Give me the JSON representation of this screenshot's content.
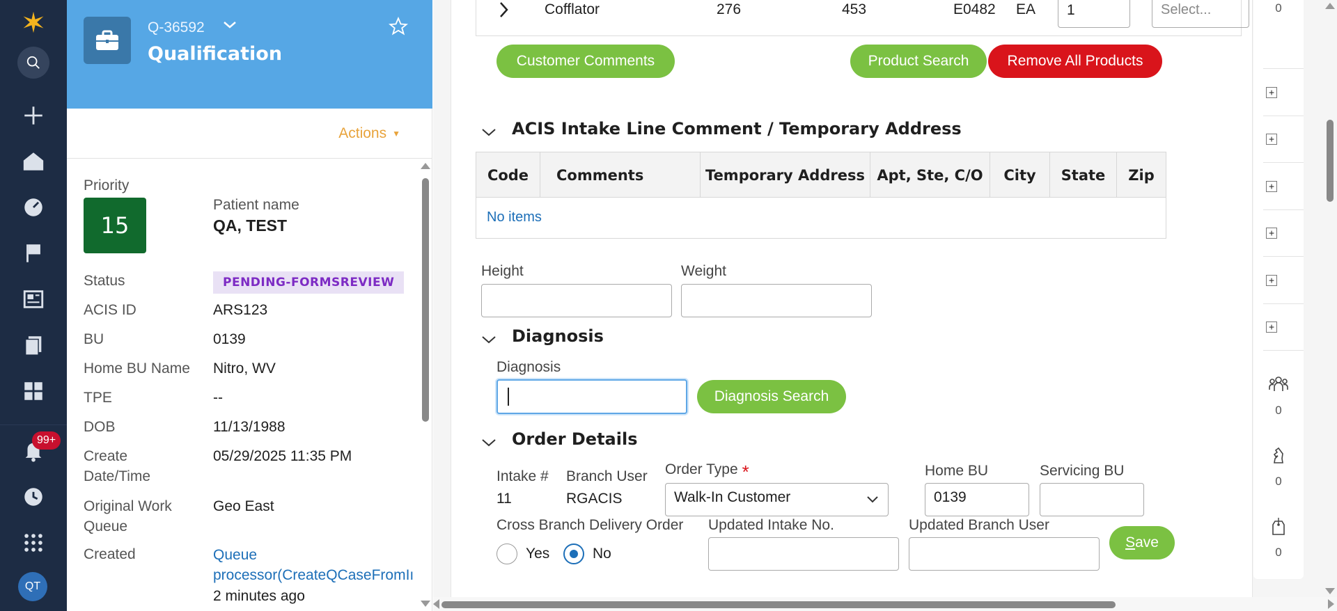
{
  "nav": {
    "notifications_badge": "99+",
    "avatar_initials": "QT"
  },
  "case": {
    "id": "Q-36592",
    "title": "Qualification",
    "actions_label": "Actions",
    "fields": {
      "priority_label": "Priority",
      "priority_value": "15",
      "patient_label": "Patient name",
      "patient_value": "QA, TEST",
      "status_label": "Status",
      "status_value": "PENDING-FORMSREVIEW",
      "acis_id_label": "ACIS ID",
      "acis_id_value": "ARS123",
      "bu_label": "BU",
      "bu_value": "0139",
      "home_bu_name_label": "Home BU Name",
      "home_bu_name_value": "Nitro, WV",
      "tpe_label": "TPE",
      "tpe_value": "--",
      "dob_label": "DOB",
      "dob_value": "11/13/1988",
      "create_date_label_1": "Create",
      "create_date_label_2": "Date/Time",
      "create_date_value": "05/29/2025 11:35 PM",
      "owq_label_1": "Original Work",
      "owq_label_2": "Queue",
      "owq_value": "Geo East",
      "created_label": "Created",
      "created_link_1": "Queue",
      "created_link_2": "processor(CreateQCaseFromIı",
      "created_time": "2 minutes ago"
    }
  },
  "product_row": {
    "name": "Cofflator",
    "col1": "276",
    "col2": "453",
    "code": "E0482",
    "unit": "EA",
    "qty": "1",
    "select_placeholder": "Select..."
  },
  "buttons": {
    "customer_comments": "Customer Comments",
    "product_search": "Product Search",
    "remove_all": "Remove All Products",
    "diagnosis_search": "Diagnosis Search",
    "save": "Save"
  },
  "intake_section": {
    "title": "ACIS Intake Line Comment / Temporary Address",
    "columns": [
      "Code",
      "Comments",
      "Temporary Address",
      "Apt, Ste, C/O",
      "City",
      "State",
      "Zip"
    ],
    "empty_text": "No items"
  },
  "measurements": {
    "height_label": "Height",
    "weight_label": "Weight",
    "height_value": "",
    "weight_value": ""
  },
  "diagnosis_section": {
    "title": "Diagnosis",
    "field_label": "Diagnosis",
    "field_value": ""
  },
  "order_details": {
    "title": "Order Details",
    "intake_label": "Intake #",
    "intake_value": "11",
    "branch_user_label": "Branch User",
    "branch_user_value": "RGACIS",
    "order_type_label": "Order Type",
    "order_type_value": "Walk-In Customer",
    "home_bu_label": "Home BU",
    "home_bu_value": "0139",
    "servicing_bu_label": "Servicing BU",
    "servicing_bu_value": "",
    "cross_branch_label": "Cross Branch Delivery Order",
    "yes_label": "Yes",
    "no_label": "No",
    "selected": "No",
    "updated_intake_label": "Updated Intake No.",
    "updated_branch_user_label": "Updated Branch User"
  },
  "utility": {
    "top_count": "0",
    "followers_count": "0",
    "chess_count": "0",
    "tag_count": "0"
  },
  "colors": {
    "nav_bg": "#1d2c44",
    "case_header": "#56a7e5",
    "priority": "#116a2d",
    "green_button": "#7bc142",
    "red_button": "#d9141b",
    "actions": "#e8a33b",
    "status_bg": "#e9e1f5",
    "status_text": "#7d2bc4"
  }
}
